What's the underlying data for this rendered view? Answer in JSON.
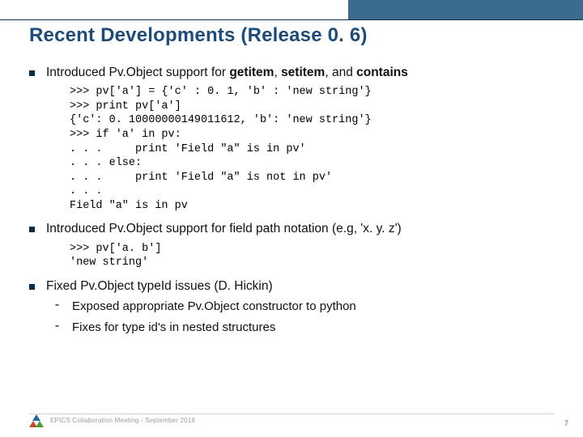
{
  "title": "Recent Developments (Release 0. 6)",
  "bullets": [
    {
      "prefix": "Introduced Pv.Object support for ",
      "bold1": "getitem",
      "mid1": ", ",
      "bold2": "setitem",
      "mid2": ", and ",
      "bold3": "contains",
      "code": ">>> pv['a'] = {'c' : 0. 1, 'b' : 'new string'}\n>>> print pv['a']\n{'c': 0. 10000000149011612, 'b': 'new string'}\n>>> if 'a' in pv:\n. . .     print 'Field \"a\" is in pv'\n. . . else:\n. . .     print 'Field \"a\" is not in pv'\n. . .\nField \"a\" is in pv"
    },
    {
      "text": "Introduced Pv.Object support for field path notation (e.g, 'x. y. z')",
      "code": ">>> pv['a. b']\n'new string'"
    },
    {
      "text": "Fixed Pv.Object typeId issues (D. Hickin)",
      "subs": [
        "Exposed appropriate Pv.Object constructor to python",
        "Fixes for type id's in nested structures"
      ]
    }
  ],
  "footer": "EPICS Collaboration Meeting  - September 2016",
  "page": "7"
}
